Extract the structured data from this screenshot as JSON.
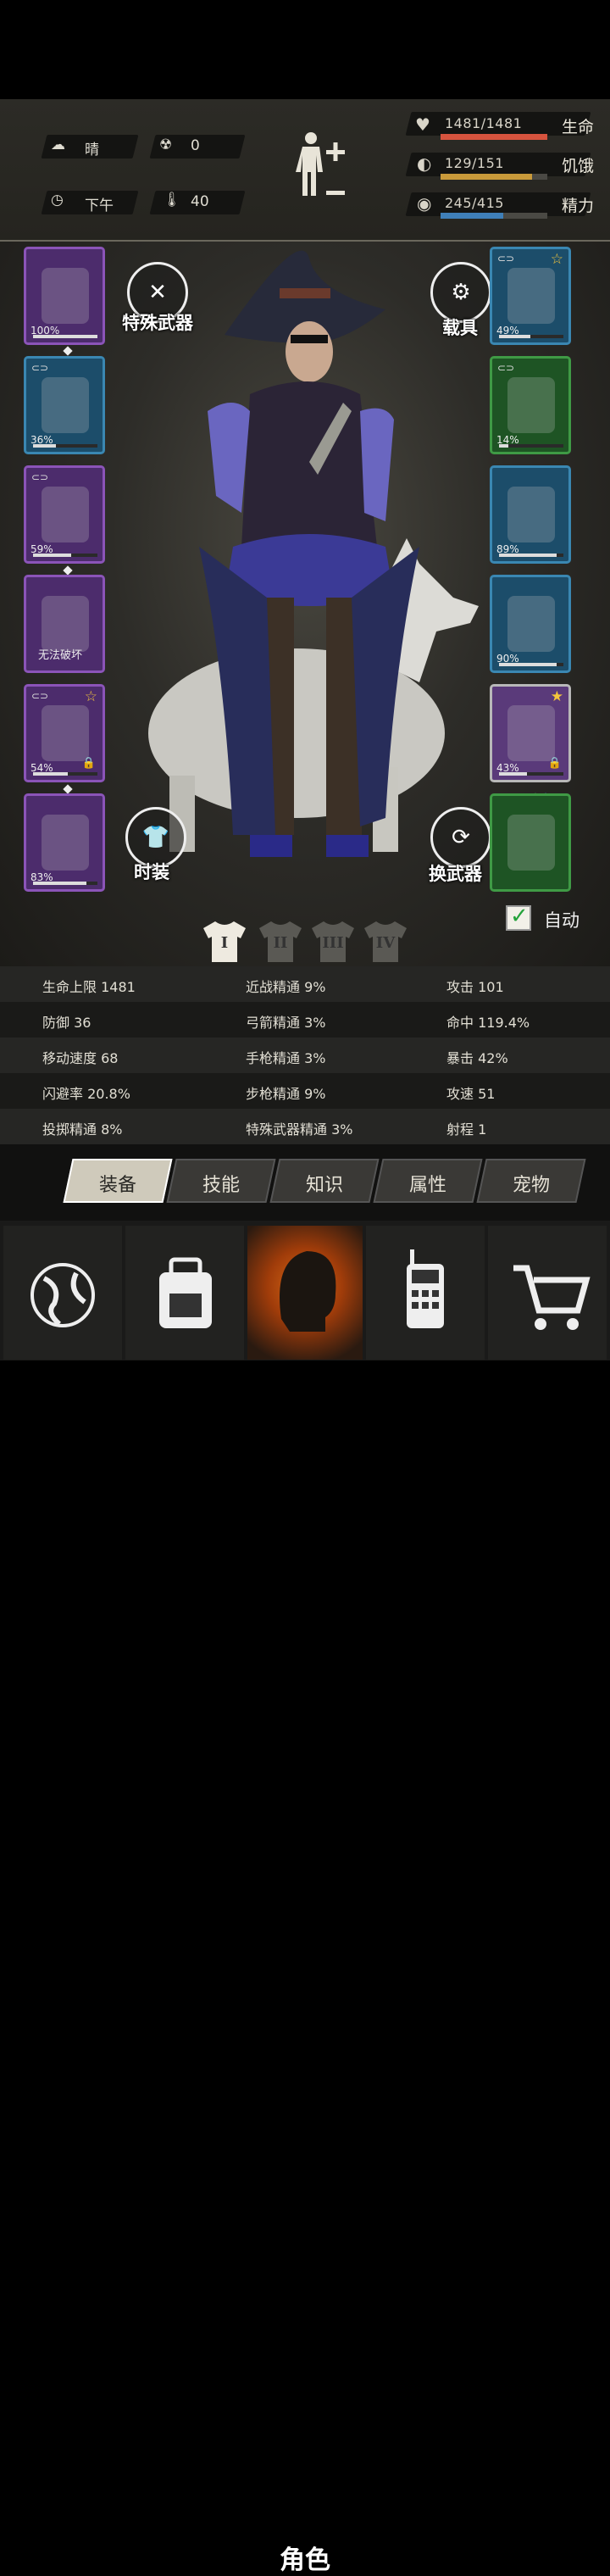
{
  "hud": {
    "weather": "晴",
    "radiation": "0",
    "time": "下午",
    "temperature": "40",
    "health": {
      "text": "1481/1481",
      "label": "生命",
      "value": 1481,
      "max": 1481,
      "color": "#d6533e"
    },
    "hunger": {
      "text": "129/151",
      "label": "饥饿",
      "value": 129,
      "max": 151,
      "color": "#c99a3a"
    },
    "energy": {
      "text": "245/415",
      "label": "精力",
      "value": 245,
      "max": 415,
      "color": "#3f7fb8"
    }
  },
  "left_slots": [
    {
      "name": "helmet",
      "pct": "100%",
      "durability": 1.0,
      "rarity": "purple",
      "icon": "football-helmet-icon"
    },
    {
      "name": "shirt",
      "pct": "36%",
      "durability": 0.36,
      "rarity": "blue",
      "icon": "shirt-icon"
    },
    {
      "name": "jacket",
      "pct": "59%",
      "durability": 0.59,
      "rarity": "purple",
      "icon": "jacket-icon"
    },
    {
      "name": "backpack",
      "pct": "无法破坏",
      "durability": null,
      "rarity": "purple",
      "icon": "backpack-icon"
    },
    {
      "name": "pants",
      "pct": "54%",
      "durability": 0.54,
      "rarity": "purple",
      "icon": "pants-icon"
    },
    {
      "name": "boots",
      "pct": "83%",
      "durability": 0.83,
      "rarity": "purple",
      "icon": "boots-icon"
    }
  ],
  "right_slots": [
    {
      "name": "glasses",
      "pct": "49%",
      "durability": 0.49,
      "rarity": "blue",
      "icon": "sunglasses-icon"
    },
    {
      "name": "mask",
      "pct": "14%",
      "durability": 0.14,
      "rarity": "green",
      "icon": "mask-icon"
    },
    {
      "name": "vest",
      "pct": "89%",
      "durability": 0.89,
      "rarity": "blue",
      "icon": "tactical-vest-icon"
    },
    {
      "name": "shield",
      "pct": "90%",
      "durability": 0.9,
      "rarity": "blue",
      "icon": "shield-icon"
    },
    {
      "name": "weapon",
      "pct": "43%",
      "durability": 0.43,
      "rarity": "gray",
      "icon": "machete-icon"
    },
    {
      "name": "bow",
      "pct": "",
      "durability": null,
      "rarity": "green",
      "icon": "bow-icon"
    }
  ],
  "buttons": {
    "special_weapon": "特殊武器",
    "vehicle": "载具",
    "fashion": "时装",
    "swap_weapon": "换武器",
    "auto": "自动"
  },
  "outfit_tabs": [
    "I",
    "II",
    "III",
    "IV"
  ],
  "stats": [
    [
      "生命上限 1481",
      "近战精通 9%",
      "攻击 101"
    ],
    [
      "防御 36",
      "弓箭精通 3%",
      "命中 119.4%"
    ],
    [
      "移动速度 68",
      "手枪精通 3%",
      "暴击 42%"
    ],
    [
      "闪避率 20.8%",
      "步枪精通 9%",
      "攻速 51"
    ],
    [
      "投掷精通 8%",
      "特殊武器精通 3%",
      "射程 1"
    ]
  ],
  "tabs": [
    "装备",
    "技能",
    "知识",
    "属性",
    "宠物"
  ],
  "active_tab": 0,
  "nav": {
    "items": [
      "globe-icon",
      "backpack-icon",
      "character-icon",
      "radio-icon",
      "cart-icon"
    ],
    "active_label": "角色"
  }
}
